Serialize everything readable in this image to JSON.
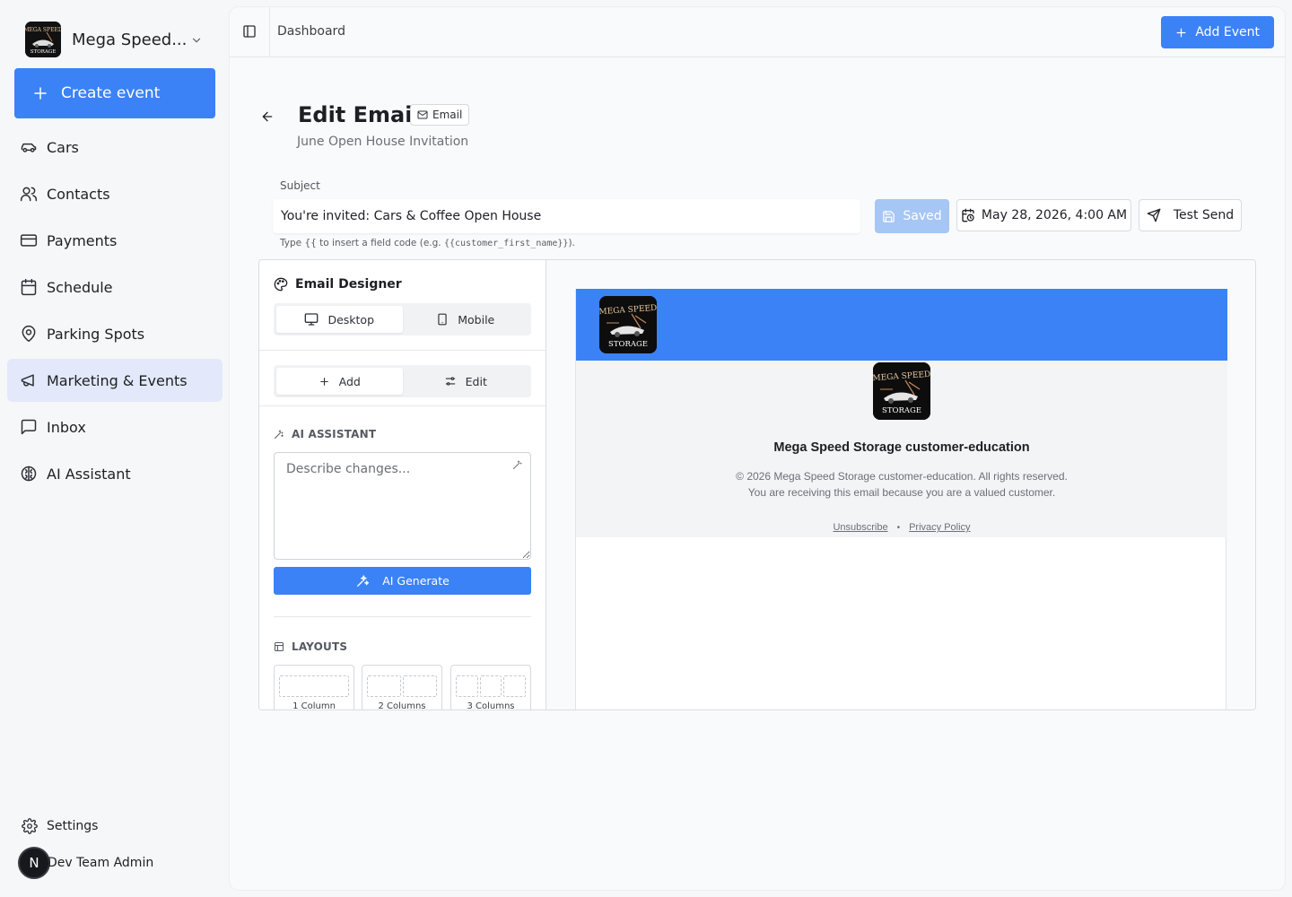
{
  "sidebar": {
    "org_name": "Mega Speed...",
    "create_label": "Create event",
    "items": [
      {
        "label": "Cars",
        "icon": "car-icon"
      },
      {
        "label": "Contacts",
        "icon": "users-icon"
      },
      {
        "label": "Payments",
        "icon": "credit-card-icon"
      },
      {
        "label": "Schedule",
        "icon": "calendar-icon"
      },
      {
        "label": "Parking Spots",
        "icon": "map-pin-icon"
      },
      {
        "label": "Marketing & Events",
        "icon": "megaphone-icon",
        "active": true
      },
      {
        "label": "Inbox",
        "icon": "message-square-icon"
      },
      {
        "label": "AI Assistant",
        "icon": "brain-icon"
      }
    ],
    "settings_label": "Settings",
    "user_initial": "N",
    "user_name": "Dev Team Admin"
  },
  "topbar": {
    "breadcrumb": "Dashboard",
    "add_event_label": "Add Event"
  },
  "page": {
    "title": "Edit Email",
    "badge": "Email",
    "subtitle": "June Open House Invitation"
  },
  "subject": {
    "label": "Subject",
    "value": "You're invited: Cars & Coffee Open House",
    "hint_prefix": "Type {{ to insert a field code (e.g. ",
    "hint_code": "{{customer_first_name}}",
    "hint_suffix": ")."
  },
  "actions": {
    "saved_label": "Saved",
    "date_label": "May 28, 2026, 4:00 AM",
    "test_send_label": "Test Send"
  },
  "designer": {
    "title": "Email Designer",
    "view_modes": [
      "Desktop",
      "Mobile"
    ],
    "active_view": "Desktop",
    "panel_tabs": [
      "Add",
      "Edit"
    ],
    "active_tab": "Add",
    "ai_heading": "AI ASSISTANT",
    "ai_placeholder": "Describe changes...",
    "ai_generate_label": "AI Generate",
    "layouts_heading": "LAYOUTS",
    "layouts": [
      {
        "label": "1 Column",
        "cols": 1
      },
      {
        "label": "2 Columns",
        "cols": 2
      },
      {
        "label": "3 Columns",
        "cols": 3
      }
    ]
  },
  "preview": {
    "logo_text_top": "MEGA SPEED",
    "logo_text_bottom": "STORAGE",
    "footer_company": "Mega Speed Storage customer-education",
    "footer_copyright": "© 2026 Mega Speed Storage customer-education. All rights reserved.",
    "footer_notice": "You are receiving this email because you are a valued customer.",
    "unsubscribe_label": "Unsubscribe",
    "separator": "•",
    "privacy_label": "Privacy Policy"
  },
  "colors": {
    "accent": "#3b82f6",
    "active_nav_bg": "#e3e9fb",
    "saved_bg": "#a6c6f5"
  }
}
